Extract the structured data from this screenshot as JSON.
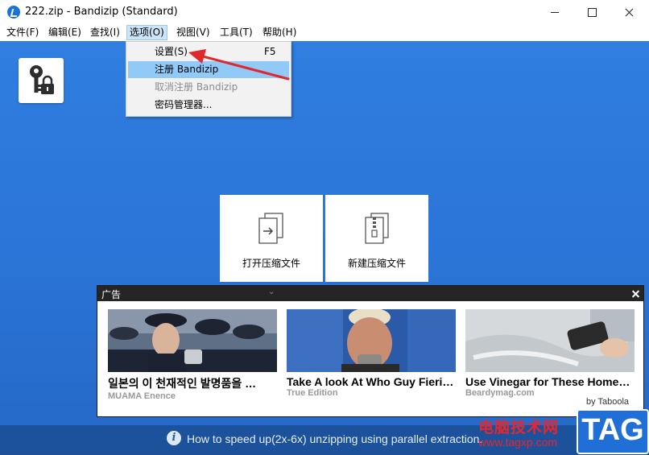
{
  "window": {
    "title": "222.zip - Bandizip (Standard)"
  },
  "menubar": {
    "items": [
      "文件(F)",
      "编辑(E)",
      "查找(I)",
      "选项(O)",
      "视图(V)",
      "工具(T)",
      "帮助(H)"
    ]
  },
  "options_menu": {
    "items": [
      {
        "label": "设置(S)",
        "shortcut": "F5",
        "state": "normal"
      },
      {
        "label": "注册 Bandizip",
        "shortcut": "",
        "state": "highlighted"
      },
      {
        "label": "取消注册 Bandizip",
        "shortcut": "",
        "state": "disabled"
      },
      {
        "label": "密码管理器...",
        "shortcut": "",
        "state": "normal"
      }
    ]
  },
  "actions": {
    "open_label": "打开压缩文件",
    "new_label": "新建压缩文件"
  },
  "ad": {
    "title": "广告",
    "cards": [
      {
        "headline": "일본의 이 천재적인 발명품을 …",
        "source": "MUAMA Enence"
      },
      {
        "headline": "Take A look At Who Guy Fieri…",
        "source": "True Edition"
      },
      {
        "headline": "Use Vinegar for These Home…",
        "source": "Beardymag.com"
      }
    ],
    "byline": "by Taboola"
  },
  "tip": {
    "text": "How to speed up(2x-6x) unzipping using parallel extraction."
  },
  "watermark": {
    "site_name": "电脑技术网",
    "url": "www.tagxp.com",
    "tag": "TAG"
  },
  "colors": {
    "background_blue": "#2a74d6",
    "menu_highlight": "#91c9f7",
    "annotation_arrow": "#e0272b"
  },
  "icons": {
    "app": "bandizip-logo-icon",
    "password_manager": "keys-lock-icon",
    "open": "open-archive-icon",
    "new": "new-archive-icon",
    "tip": "info-icon"
  }
}
